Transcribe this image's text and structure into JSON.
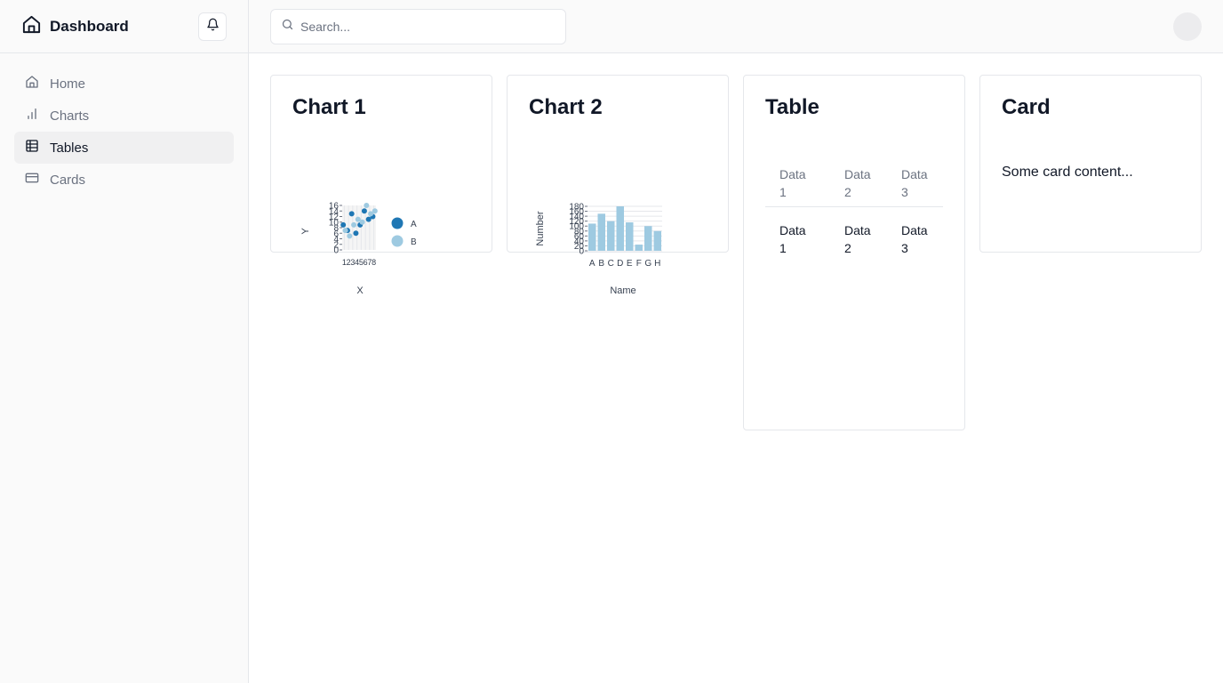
{
  "app": {
    "title": "Dashboard"
  },
  "sidebar": {
    "items": [
      {
        "label": "Home",
        "icon": "home-icon",
        "active": false
      },
      {
        "label": "Charts",
        "icon": "bar-chart-icon",
        "active": false
      },
      {
        "label": "Tables",
        "icon": "table-icon",
        "active": true
      },
      {
        "label": "Cards",
        "icon": "credit-card-icon",
        "active": false
      }
    ]
  },
  "header": {
    "search_placeholder": "Search..."
  },
  "cards": {
    "chart1": {
      "title": "Chart 1"
    },
    "chart2": {
      "title": "Chart 2"
    },
    "table": {
      "title": "Table"
    },
    "card": {
      "title": "Card",
      "content": "Some card content..."
    }
  },
  "table": {
    "columns": [
      "Data 1",
      "Data 2",
      "Data 3"
    ],
    "rows": [
      [
        "Data 1",
        "Data 2",
        "Data 3"
      ]
    ]
  },
  "colors": {
    "series_a": "#1f77b4",
    "series_b": "#9ecae1",
    "bars": "#9ecae1",
    "grid": "#e5e7eb",
    "active_nav_bg": "#f0f0f1"
  },
  "chart_data": [
    {
      "type": "scatter",
      "title": "",
      "xlabel": "X",
      "ylabel": "Y",
      "ylim": [
        0,
        16
      ],
      "yticks": [
        0,
        2,
        4,
        6,
        8,
        10,
        12,
        14,
        16
      ],
      "grid": true,
      "legend_position": "right",
      "series": [
        {
          "name": "A",
          "x": [
            1,
            2,
            3,
            4,
            5,
            6,
            7,
            8
          ],
          "values": [
            9,
            7,
            13,
            6,
            9,
            14,
            11,
            12
          ]
        },
        {
          "name": "B",
          "x": [
            1,
            2,
            3,
            4,
            5,
            6,
            7,
            8
          ],
          "values": [
            7,
            5,
            9,
            11,
            10,
            16,
            13,
            14
          ]
        }
      ]
    },
    {
      "type": "bar",
      "title": "",
      "xlabel": "Name",
      "ylabel": "Number",
      "categories": [
        "A",
        "B",
        "C",
        "D",
        "E",
        "F",
        "G",
        "H"
      ],
      "values": [
        110,
        150,
        120,
        180,
        115,
        25,
        100,
        80
      ],
      "ylim": [
        0,
        180
      ],
      "yticks": [
        0,
        20,
        40,
        60,
        80,
        100,
        120,
        140,
        160,
        180
      ],
      "grid": true
    }
  ]
}
